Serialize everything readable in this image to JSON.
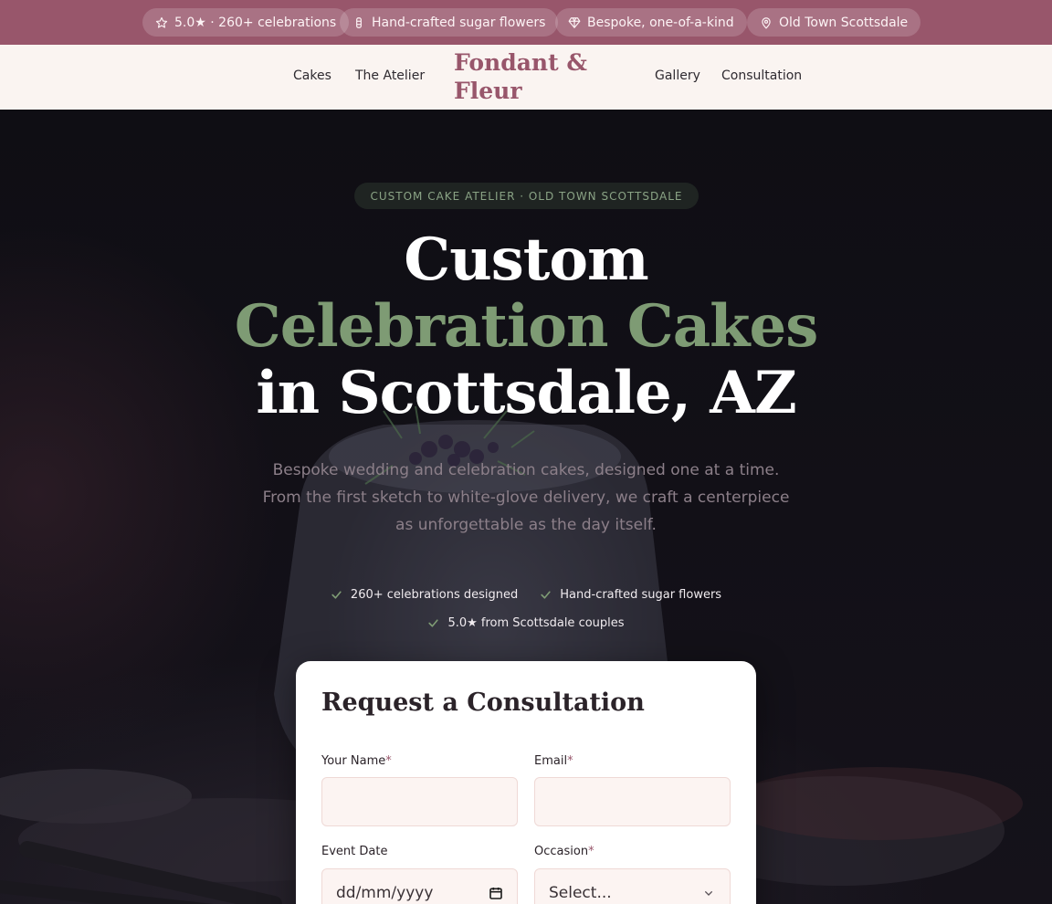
{
  "topbar": {
    "pills": [
      {
        "icon": "star-icon",
        "text": "5.0★ · 260+ celebrations"
      },
      {
        "icon": "flower-icon",
        "text": "Hand-crafted sugar flowers"
      },
      {
        "icon": "gem-icon",
        "text": "Bespoke, one-of-a-kind"
      },
      {
        "icon": "map-pin-icon",
        "text": "Old Town Scottsdale"
      }
    ]
  },
  "nav": {
    "left_links": [
      "Cakes",
      "The Atelier"
    ],
    "logo_line1": "Fondant &",
    "logo_line2": "Fleur",
    "right_links": [
      "Gallery",
      "Consultation"
    ]
  },
  "hero": {
    "eyebrow": "CUSTOM CAKE ATELIER · OLD TOWN SCOTTSDALE",
    "headline_line1": "Custom",
    "headline_line2": "Celebration Cakes",
    "headline_line3": "in Scottsdale, AZ",
    "subtext": "Bespoke wedding and celebration cakes, designed one at a time. From the first sketch to white-glove delivery, we craft a centerpiece as unforgettable as the day itself.",
    "checks": [
      "260+ celebrations designed",
      "Hand-crafted sugar flowers",
      "5.0★ from Scottsdale couples"
    ]
  },
  "form": {
    "title": "Request a Consultation",
    "name_label": "Your Name",
    "email_label": "Email",
    "date_label": "Event Date",
    "date_placeholder": "dd/mm/yyyy",
    "occasion_label": "Occasion",
    "occasion_value": "Select...",
    "required_mark": "*"
  },
  "colors": {
    "brand": "#98566b",
    "accent_green": "#7e9b74",
    "nav_bg": "#faf4f1",
    "field_bg": "#fcf4f2"
  }
}
